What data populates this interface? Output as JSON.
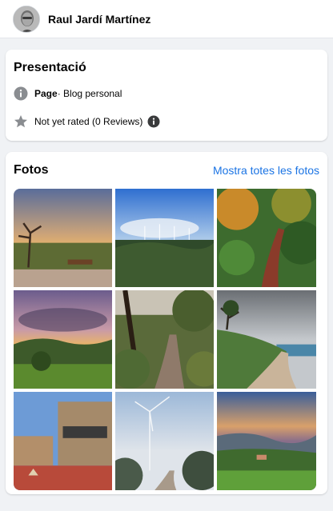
{
  "profile": {
    "name": "Raul Jardí Martínez"
  },
  "intro": {
    "title": "Presentació",
    "category_label": "Page",
    "category_rest": " · Blog personal",
    "rating_text": "Not yet rated (0 Reviews)",
    "icons": {
      "info": "info-icon",
      "star": "star-icon"
    }
  },
  "photos": {
    "title": "Fotos",
    "see_all": "Mostra totes les fotos",
    "items": [
      {
        "name": "photo-sunset-tree-bench"
      },
      {
        "name": "photo-wind-turbines-hills"
      },
      {
        "name": "photo-forest-path-autumn"
      },
      {
        "name": "photo-purple-clouds-field"
      },
      {
        "name": "photo-forest-trail-pines"
      },
      {
        "name": "photo-coastal-road-sea"
      },
      {
        "name": "photo-stone-building-street"
      },
      {
        "name": "photo-wind-turbine-fog"
      },
      {
        "name": "photo-valley-sunset-fields"
      }
    ]
  },
  "colors": {
    "link": "#1b74e4",
    "background": "#f0f2f5",
    "icon": "#65676b"
  }
}
